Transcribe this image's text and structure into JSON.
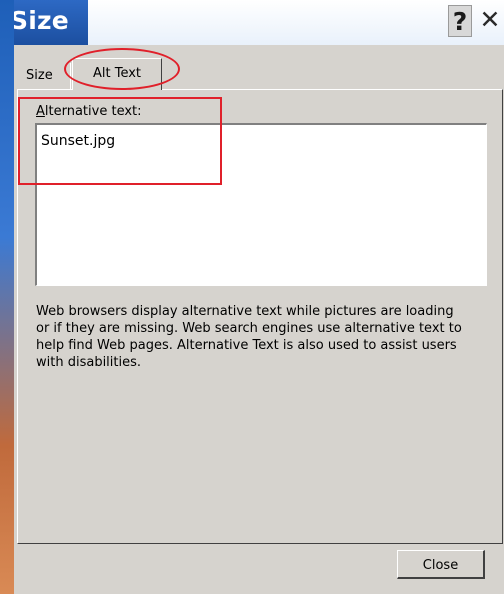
{
  "window": {
    "title": "Size",
    "help_label": "?",
    "close_label": "✕"
  },
  "tabs": [
    {
      "label": "Size",
      "selected": false
    },
    {
      "label": "Alt Text",
      "selected": true
    }
  ],
  "alt_text": {
    "label_mnemonic": "A",
    "label_rest": "lternative text:",
    "value": "Sunset.jpg"
  },
  "description": "Web browsers display alternative text while pictures are loading\nor if they are missing.  Web search engines use alternative text to\nhelp find Web pages.  Alternative Text is also used to assist users\nwith disabilities.",
  "buttons": {
    "close_label": "Close"
  },
  "colors": {
    "dialog_background": "#d6d3ce",
    "title_background": "#1c4fa0",
    "annotation_red": "#e0202a"
  }
}
